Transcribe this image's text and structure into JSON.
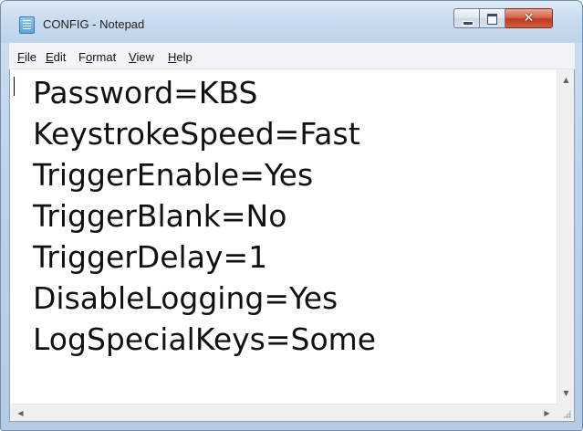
{
  "window": {
    "title": "CONFIG - Notepad",
    "app_icon": "notepad-icon"
  },
  "caption_buttons": {
    "minimize": "minimize-icon",
    "maximize": "maximize-icon",
    "close": "close-icon",
    "close_glyph": "✕"
  },
  "menubar": {
    "items": [
      {
        "accel": "F",
        "rest": "ile"
      },
      {
        "accel": "E",
        "rest": "dit"
      },
      {
        "pre": "F",
        "accel": "o",
        "rest": "rmat"
      },
      {
        "accel": "V",
        "rest": "iew"
      },
      {
        "accel": "H",
        "rest": "elp"
      }
    ]
  },
  "editor": {
    "lines": [
      "Password=KBS",
      "KeystrokeSpeed=Fast",
      "TriggerEnable=Yes",
      "TriggerBlank=No",
      "TriggerDelay=1",
      "DisableLogging=Yes",
      "LogSpecialKeys=Some"
    ]
  },
  "scrollbars": {
    "up_arrow": "▲",
    "down_arrow": "▼",
    "left_arrow": "◀",
    "right_arrow": "▶"
  },
  "colors": {
    "title_bar": "#c9dbef",
    "close_button": "#c0391f",
    "editor_background": "#ffffff"
  }
}
